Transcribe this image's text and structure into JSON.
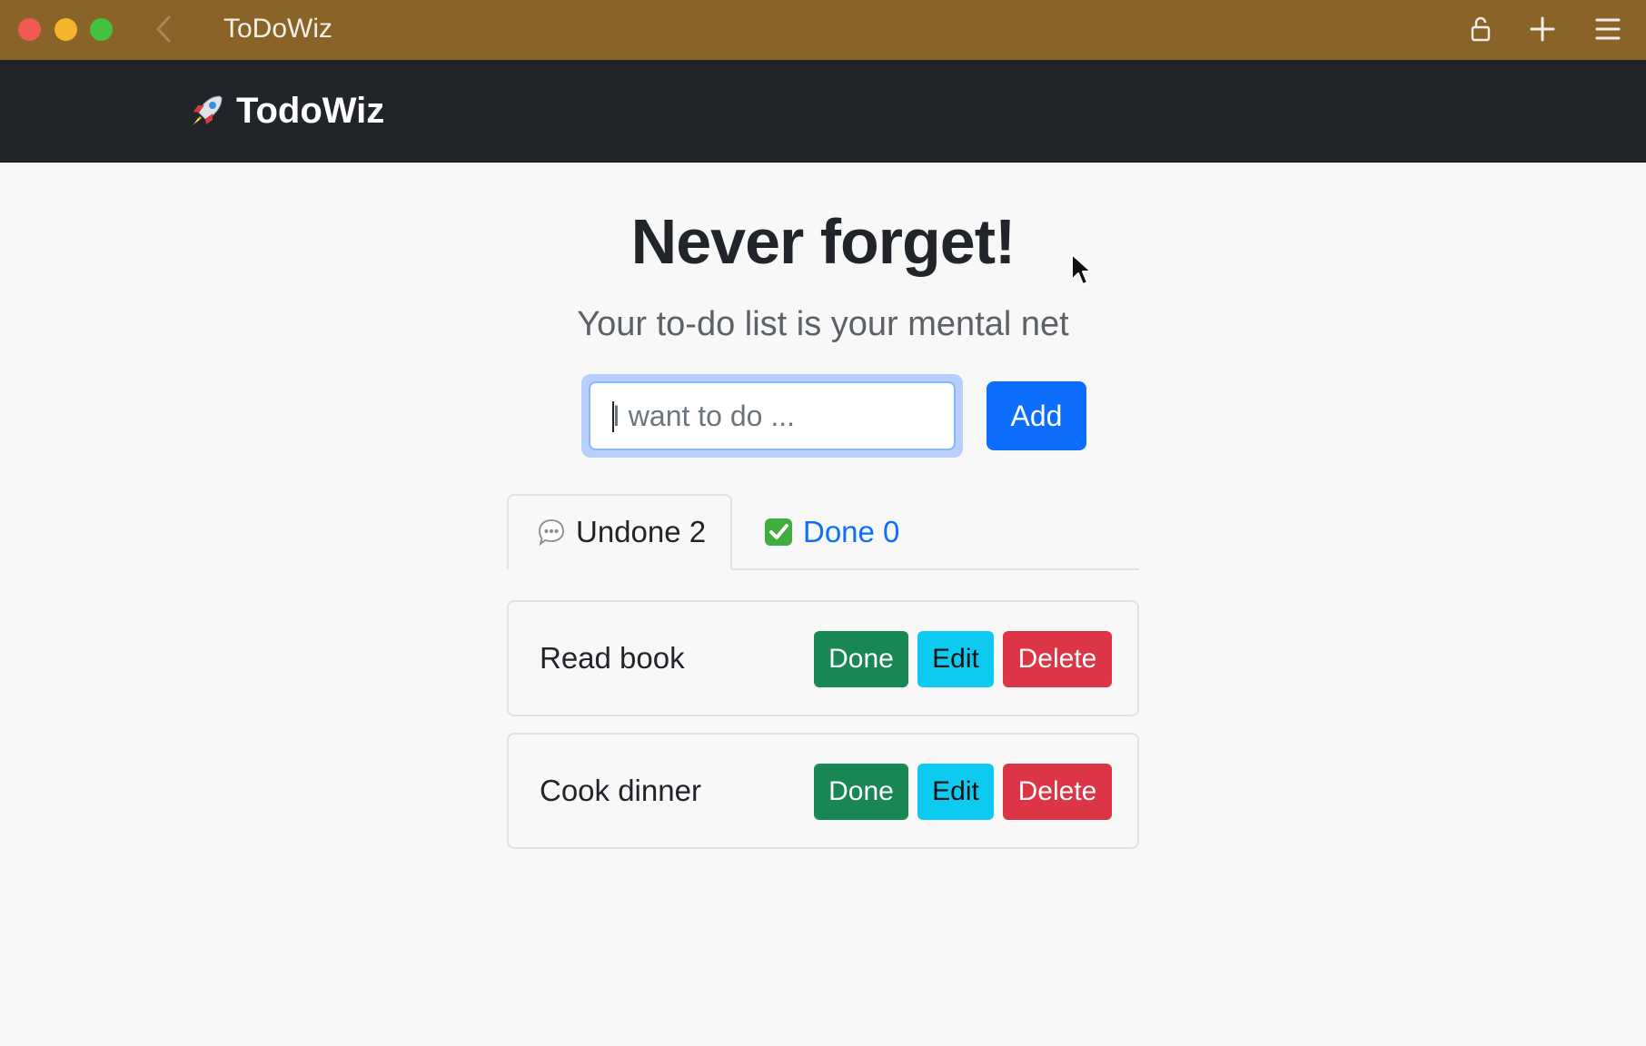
{
  "window": {
    "title": "ToDoWiz"
  },
  "navbar": {
    "brand_label": "TodoWiz",
    "brand_icon": "rocket-icon"
  },
  "hero": {
    "title": "Never forget!",
    "subtitle": "Your to-do list is your mental net"
  },
  "form": {
    "input_placeholder": "I want to do ...",
    "input_value": "",
    "add_label": "Add"
  },
  "tabs": [
    {
      "icon": "speech-bubble-icon",
      "label": "Undone 2",
      "active": true
    },
    {
      "icon": "check-mark-button-icon",
      "label": "Done 0",
      "active": false
    }
  ],
  "todos": [
    {
      "text": "Read book",
      "done_label": "Done",
      "edit_label": "Edit",
      "delete_label": "Delete"
    },
    {
      "text": "Cook dinner",
      "done_label": "Done",
      "edit_label": "Edit",
      "delete_label": "Delete"
    }
  ],
  "colors": {
    "titlebar": "#8a6329",
    "navbar": "#212529",
    "primary": "#0d6efd",
    "success": "#198754",
    "info": "#0dcaf0",
    "danger": "#dc3545"
  }
}
